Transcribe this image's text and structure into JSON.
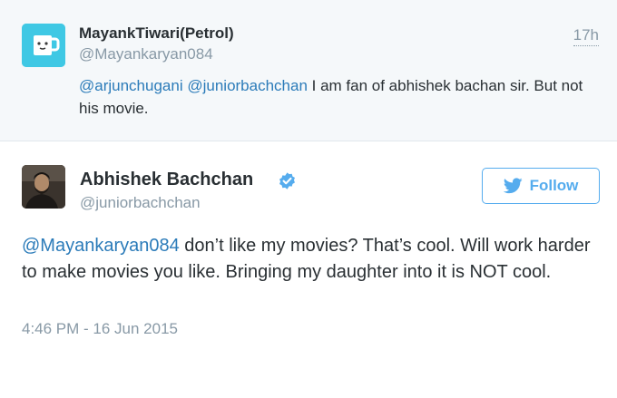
{
  "reply_tweet": {
    "name": "MayankTiwari(Petrol)",
    "handle": "@Mayankaryan084",
    "time": "17h",
    "mention_1": "@arjunchugani",
    "mention_2": "@juniorbachchan",
    "text": " I am fan of abhishek bachan sir. But not his movie.",
    "avatar_icon": "mug-icon",
    "avatar_color": "#3fc8e4"
  },
  "main_tweet": {
    "name": "Abhishek Bachchan",
    "handle": "@juniorbachchan",
    "verified_icon": "verified-badge-icon",
    "follow_label": "Follow",
    "mention": "@Mayankaryan084",
    "text": " don’t like my movies? That’s cool. Will work harder to make movies you like. Bringing my daughter into it is NOT cool.",
    "timestamp": "4:46 PM - 16 Jun 2015"
  },
  "colors": {
    "link": "#2b7bb9",
    "twitter_blue": "#55acee",
    "muted": "#8899a6",
    "text": "#292f33",
    "reply_background": "#f5f8fa"
  }
}
